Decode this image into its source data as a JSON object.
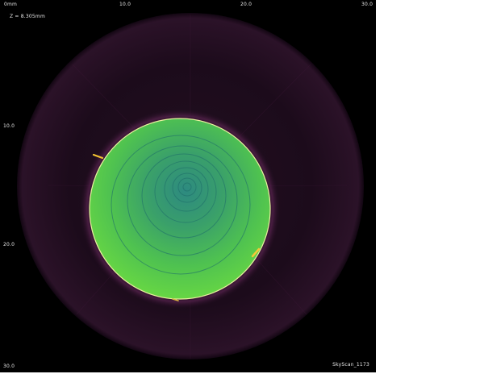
{
  "viewer": {
    "z_label": "Z = 8.305mm",
    "brand": "SkyScan_1173",
    "x_ticks": [
      "0mm",
      "10.0",
      "20.0",
      "30.0"
    ],
    "y_ticks": [
      "10.0",
      "20.0",
      "30.0"
    ]
  },
  "colors": {
    "background": "#000000",
    "outer_ring": "#1b0b1a",
    "sample_edge": "#6fd94a",
    "sample_center": "#2f8e7f",
    "highlight": "#f0c030"
  }
}
